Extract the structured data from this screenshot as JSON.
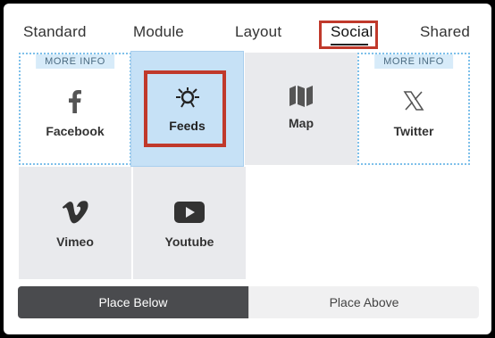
{
  "tabs": {
    "standard": "Standard",
    "module": "Module",
    "layout": "Layout",
    "social": "Social",
    "shared": "Shared",
    "active": "Social"
  },
  "tiles": {
    "facebook": {
      "label": "Facebook",
      "badge": "MORE INFO",
      "icon": "facebook-icon"
    },
    "feeds": {
      "label": "Feeds",
      "icon": "feeds-icon",
      "selected": true
    },
    "map": {
      "label": "Map",
      "icon": "map-icon"
    },
    "twitter": {
      "label": "Twitter",
      "badge": "MORE INFO",
      "icon": "x-twitter-icon"
    },
    "vimeo": {
      "label": "Vimeo",
      "icon": "vimeo-icon"
    },
    "youtube": {
      "label": "Youtube",
      "icon": "youtube-icon"
    }
  },
  "placement": {
    "below": "Place Below",
    "above": "Place Above",
    "active": "Place Below"
  },
  "colors": {
    "highlight": "#c0392b",
    "selected_tile": "#c6e1f6",
    "tile": "#e9eaed",
    "active_button": "#4a4b4e"
  }
}
